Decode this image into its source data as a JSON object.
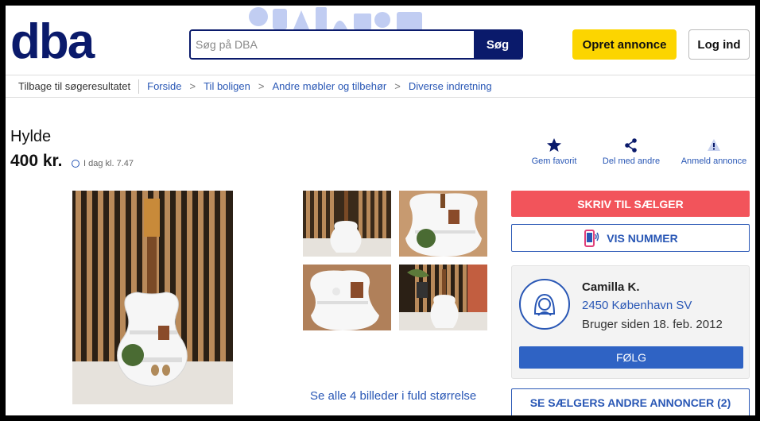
{
  "header": {
    "logo_text": "dba",
    "search_placeholder": "Søg på DBA",
    "search_button": "Søg",
    "create_button": "Opret annonce",
    "login_button": "Log ind"
  },
  "breadcrumb": {
    "back": "Tilbage til søgeresultatet",
    "items": [
      "Forside",
      "Til boligen",
      "Andre møbler og tilbehør",
      "Diverse indretning"
    ]
  },
  "listing": {
    "title": "Hylde",
    "price": "400 kr.",
    "posted": "I dag kl. 7.47"
  },
  "actions": {
    "favorite": "Gem favorit",
    "share": "Del med andre",
    "report": "Anmeld annonce"
  },
  "gallery": {
    "see_all": "Se alle 4 billeder i fuld størrelse"
  },
  "contact": {
    "message_button": "SKRIV TIL SÆLGER",
    "phone_button": "VIS NUMMER"
  },
  "seller": {
    "name": "Camilla K.",
    "location": "2450 København SV",
    "member_since": "Bruger siden 18. feb. 2012",
    "follow_button": "FØLG",
    "other_ads_button": "SE SÆLGERS ANDRE ANNONCER (2)"
  },
  "colors": {
    "brand": "#0a1a6b",
    "link": "#2957b5",
    "create_button": "#fcd500",
    "message_button": "#f2545b",
    "follow_button": "#2f63c4"
  }
}
